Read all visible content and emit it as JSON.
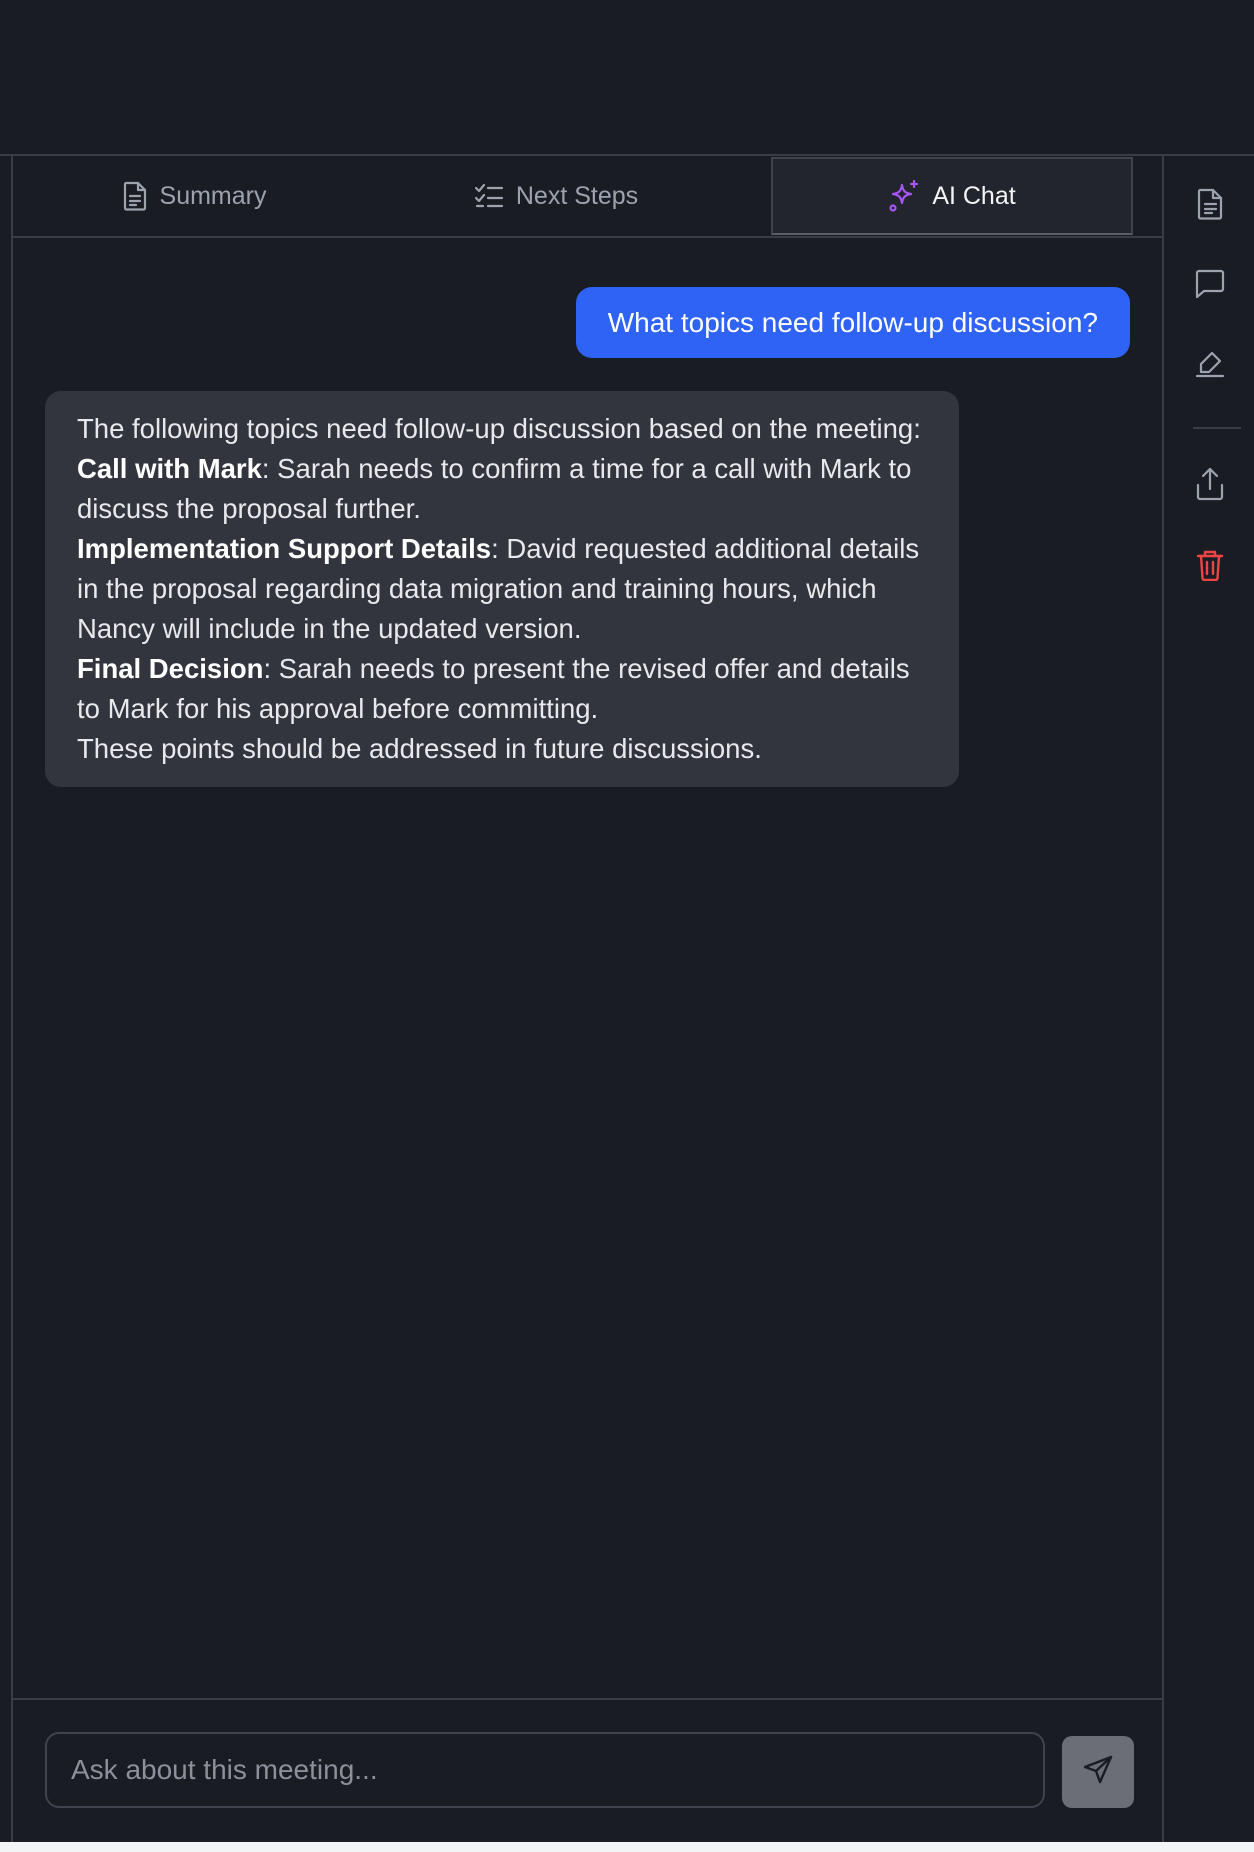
{
  "tabs": [
    {
      "label": "Summary",
      "icon": "document-icon",
      "active": false
    },
    {
      "label": "Next Steps",
      "icon": "checklist-icon",
      "active": false
    },
    {
      "label": "AI Chat",
      "icon": "sparkles-icon",
      "active": true
    }
  ],
  "chat": {
    "user_message": "What topics need follow-up discussion?",
    "ai_response": {
      "intro": "The following topics need follow-up discussion based on the meeting:",
      "items": [
        {
          "title": "Call with Mark",
          "text": ": Sarah needs to confirm a time for a call with Mark to discuss the proposal further."
        },
        {
          "title": "Implementation Support Details",
          "text": ": David requested additional details in the proposal regarding data migration and training hours, which Nancy will include in the updated version."
        },
        {
          "title": "Final Decision",
          "text": ": Sarah needs to present the revised offer and details to Mark for his approval before committing."
        }
      ],
      "closing": "These points should be addressed in future discussions."
    }
  },
  "input": {
    "placeholder": "Ask about this meeting...",
    "value": ""
  },
  "rail": {
    "items": [
      {
        "icon": "document-icon"
      },
      {
        "icon": "comment-icon"
      },
      {
        "icon": "highlighter-icon"
      },
      {
        "icon": "share-icon"
      },
      {
        "icon": "trash-icon"
      }
    ]
  },
  "colors": {
    "background": "#1a1c24",
    "accent_blue": "#2f63f5",
    "ai_bubble": "#32353e",
    "sparkle_purple": "#a855f7",
    "danger_red": "#ef4444"
  }
}
